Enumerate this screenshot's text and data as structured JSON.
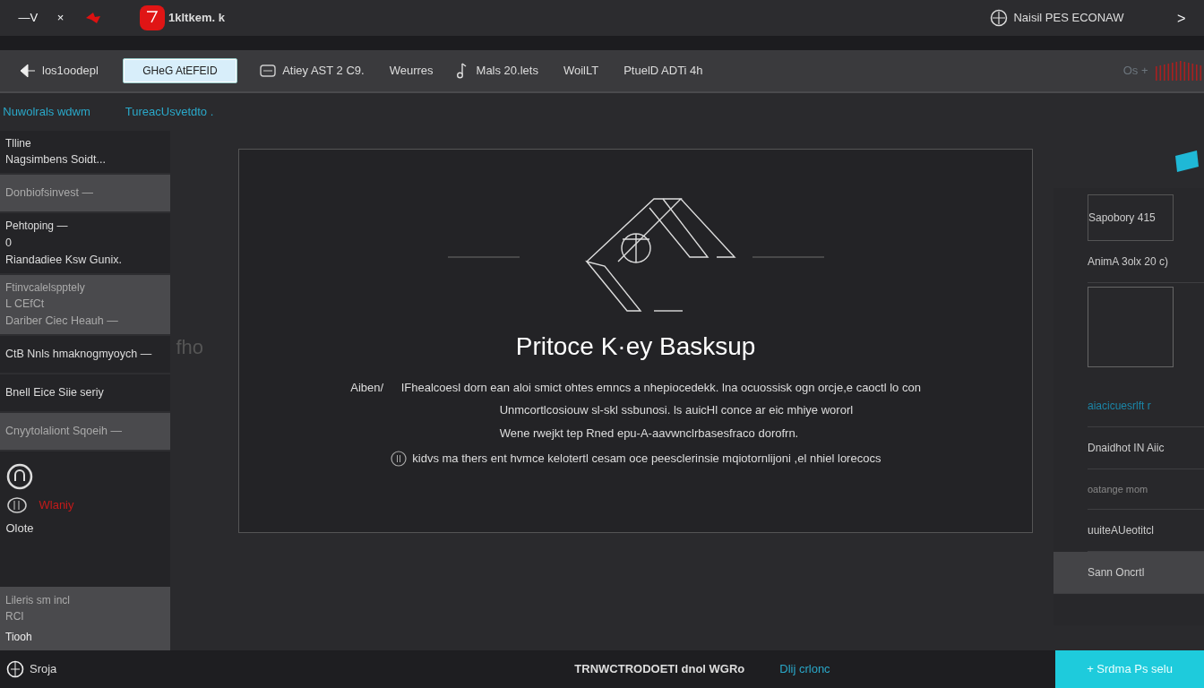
{
  "window": {
    "controls": [
      "—V",
      "×"
    ],
    "app_title": "1kltkem. k",
    "account": "Naisil PES ECONAW",
    "forward": ">"
  },
  "toolbar": {
    "items": [
      {
        "kind": "icon-text",
        "label": "los1oodepl",
        "selected": false
      },
      {
        "kind": "field",
        "label": "GHeG AtEFEID",
        "selected": true
      },
      {
        "kind": "icon-text",
        "label": "Atiey AST 2 C9.",
        "selected": false
      },
      {
        "kind": "text",
        "label": "Weurres",
        "selected": false
      },
      {
        "kind": "icon-text",
        "label": "Mals 20.lets",
        "selected": false
      },
      {
        "kind": "text",
        "label": "WoilLT",
        "selected": false
      },
      {
        "kind": "text",
        "label": "PtuelD ADTi 4h",
        "selected": false
      }
    ],
    "right_label": "Os +"
  },
  "breadcrumbs": [
    "Nuwolrals wdwm",
    "TureacUsvetdto ."
  ],
  "sidebar": {
    "items": [
      {
        "lines": [
          "Tlline",
          "Nagsimbens Soidt..."
        ],
        "highlighted": false
      },
      {
        "lines": [
          "Donbiofsinvest —"
        ],
        "highlighted": true
      },
      {
        "lines": [
          "Pehtoping —",
          "0",
          "Riandadiee Ksw Gunix."
        ],
        "highlighted": false
      },
      {
        "lines": [
          "Ftinvcalelspptely",
          "L CEfCt",
          "Dariber Ciec Heauh —"
        ],
        "highlighted": true
      },
      {
        "lines": [
          "CtB Nnls hmaknogmyoych —"
        ],
        "highlighted": false
      },
      {
        "lines": [
          "Bnell Eice Siie seriy"
        ],
        "highlighted": false
      },
      {
        "lines": [
          "Cnyytolaliont Sqoeih —"
        ],
        "highlighted": true
      }
    ],
    "status": {
      "alert": "Wlaniy",
      "note": "Olote"
    },
    "footer_item": {
      "lines": [
        "Lileris sm incl",
        "RCI",
        "Tiooh"
      ]
    }
  },
  "canvas_label": "fho",
  "panel": {
    "title": "Pritoce K·ey Basksup",
    "lead": "Aiben/",
    "paragraph": [
      "IFhealcoesl dorn ean aloi smict ohtes emncs a nhepiocedekk. lna ocuossisk ogn orcje,e caoctl lo con",
      "Unmcortlcosiouw sl-skl ssbunosi. ls auicHl conce ar eic mhiye wororl",
      "Wene rwejkt tep Rned epu-A-aavwnclrbasesfraco dorofrn."
    ],
    "info": "kidvs ma thers ent hvmce kelotertl cesam oce peesclerinsie mqiotornlijoni ,el nhiel lorecocs"
  },
  "right_panel": {
    "items": [
      {
        "kind": "boxed",
        "label": "Sapobory 415",
        "selected": false
      },
      {
        "kind": "plain",
        "label": "AnimA 3olx 20 c)",
        "selected": false
      },
      {
        "kind": "preview",
        "selected": false
      },
      {
        "kind": "link",
        "label": "aiacicuesrlft r",
        "selected": false
      },
      {
        "kind": "plain",
        "label": "Dnaidhot IN Aiic",
        "selected": false
      },
      {
        "kind": "dim",
        "label": "oatange mom",
        "selected": false
      },
      {
        "kind": "plain",
        "label": "uuiteAUeotitcl",
        "selected": false
      },
      {
        "kind": "plain",
        "label": "Sann Oncrtl",
        "selected": true
      }
    ]
  },
  "status_bar": {
    "user": "Sroja",
    "center": "TRNWCTRODOETI dnol WGRo",
    "link": "Dlij crlonc",
    "action": "+ Srdma Ps selu"
  }
}
